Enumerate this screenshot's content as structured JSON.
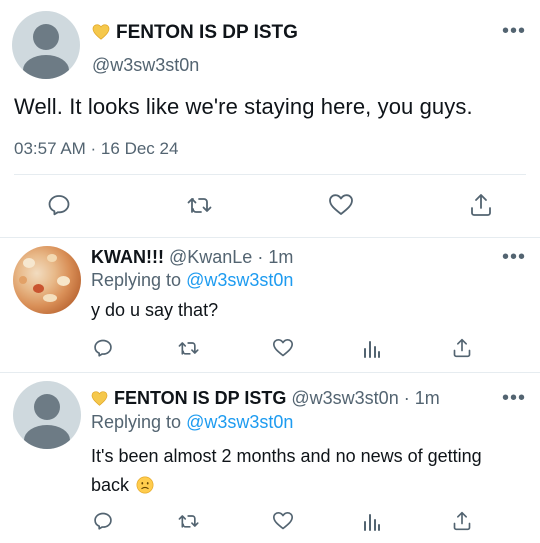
{
  "main_tweet": {
    "display_name": "FENTON IS DP ISTG",
    "name_emoji": "yellow-heart",
    "handle": "@w3sw3st0n",
    "text": "Well. It looks like we're staying here, you guys.",
    "timestamp": "03:57 AM · 16 Dec 24"
  },
  "reply_1": {
    "display_name": "KWAN!!!",
    "handle": "@KwanLe",
    "time": "· 1m",
    "replying_label": "Replying to",
    "replying_handle": "@w3sw3st0n",
    "text": "y do u say that?"
  },
  "reply_2": {
    "display_name": "FENTON IS DP ISTG",
    "name_emoji": "yellow-heart",
    "handle": "@w3sw3st0n",
    "time": "· 1m",
    "replying_label": "Replying to",
    "replying_handle": "@w3sw3st0n",
    "text_line_1": "It's been almost 2 months and no news of getting",
    "text_line_2": "back"
  },
  "icons": [
    "reply-icon",
    "retweet-icon",
    "like-icon",
    "analytics-icon",
    "share-icon",
    "more-icon"
  ],
  "colors": {
    "accent": "#1d9bf0",
    "secondary_text": "#536471",
    "divider": "#e6ecf0"
  }
}
